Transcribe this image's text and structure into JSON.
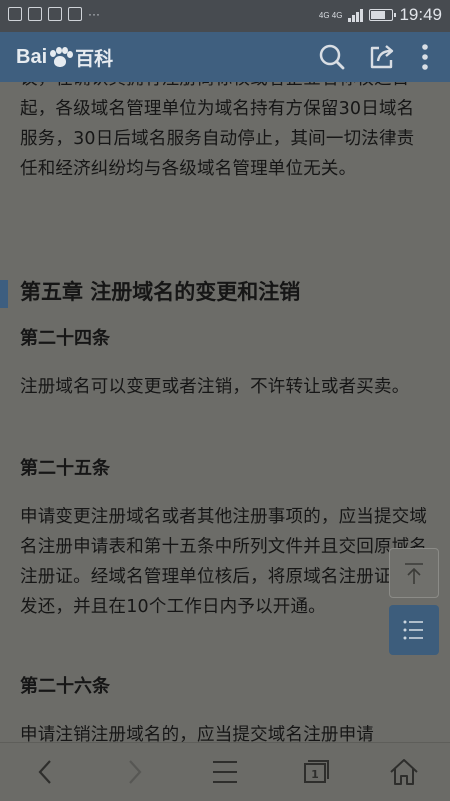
{
  "status_bar": {
    "network": "4G 4G",
    "time": "19:49"
  },
  "header": {
    "logo_text_left": "Bai",
    "logo_text_paw": "du",
    "logo_text_cn": "百科",
    "icons": [
      "search-icon",
      "share-icon",
      "more-icon"
    ]
  },
  "article": {
    "intro_paragraph": "议，在确认其拥有注册商标权或者企业名称权之日起，各级域名管理单位为域名持有方保留30日域名服务，30日后域名服务自动停止，其间一切法律责任和经济纠纷均与各级域名管理单位无关。",
    "chapter_title": "第五章 注册域名的变更和注销",
    "articles": [
      {
        "title": "第二十四条",
        "text": "注册域名可以变更或者注销，不许转让或者买卖。"
      },
      {
        "title": "第二十五条",
        "text": "申请变更注册域名或者其他注册事项的，应当提交域名注册申请表和第十五条中所列文件并且交回原域名注册证。经域名管理单位核后，将原域名注册证加注发还，并且在10个工作日内予以开通。"
      },
      {
        "title": "第二十六条",
        "text": "申请注销注册域名的，应当提交域名注册申请"
      }
    ]
  },
  "floating_buttons": {
    "back_to_top_icon": "arrow-up-to-top-icon",
    "toc_icon": "list-icon"
  },
  "bottom_nav": {
    "tab_count": "1",
    "icons": [
      "back-icon",
      "forward-icon",
      "menu-icon",
      "tabs-icon",
      "home-icon"
    ]
  },
  "colors": {
    "status_bar": "#474b50",
    "header": "#3f5f7f",
    "content_bg": "#6c6c68",
    "accent": "#3d5e80"
  }
}
